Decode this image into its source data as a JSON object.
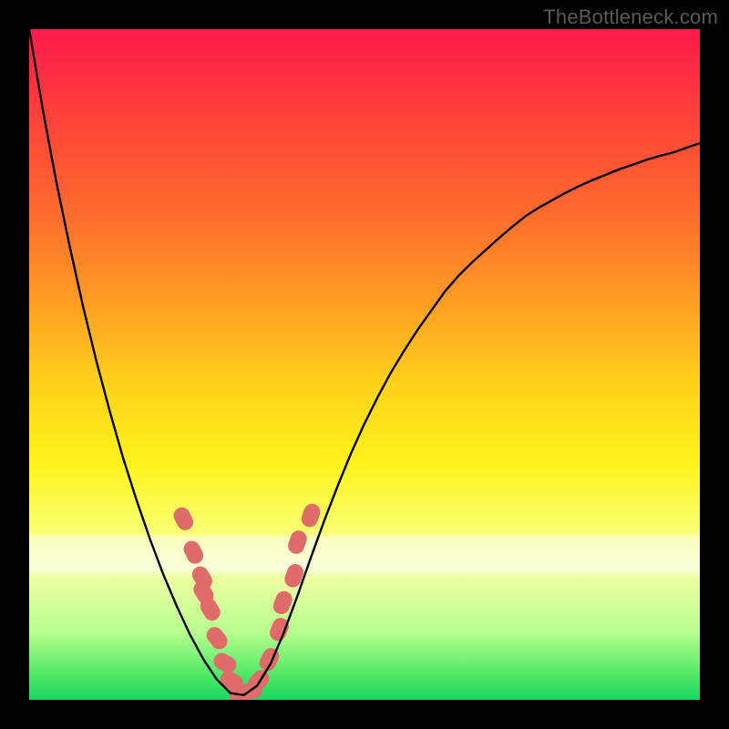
{
  "watermark": "TheBottleneck.com",
  "colors": {
    "frame": "#000000",
    "curve": "#000000",
    "marker_fill": "#e06b6b",
    "marker_stroke": "#c24e4e",
    "gradient_top": "#ff1a4b",
    "gradient_bottom": "#18d85e"
  },
  "chart_data": {
    "type": "line",
    "title": "",
    "xlabel": "",
    "ylabel": "",
    "x": [
      0.0,
      0.02,
      0.04,
      0.06,
      0.08,
      0.1,
      0.12,
      0.14,
      0.16,
      0.18,
      0.2,
      0.22,
      0.24,
      0.26,
      0.28,
      0.3,
      0.32,
      0.34,
      0.36,
      0.38,
      0.4,
      0.42,
      0.44,
      0.46,
      0.48,
      0.5,
      0.52,
      0.54,
      0.56,
      0.58,
      0.6,
      0.62,
      0.64,
      0.66,
      0.68,
      0.7,
      0.72,
      0.74,
      0.76,
      0.78,
      0.8,
      0.82,
      0.84,
      0.86,
      0.88,
      0.9,
      0.92,
      0.94,
      0.96,
      0.98,
      1.0
    ],
    "y": [
      1.0,
      0.882,
      0.775,
      0.678,
      0.588,
      0.506,
      0.431,
      0.361,
      0.298,
      0.24,
      0.187,
      0.14,
      0.097,
      0.06,
      0.03,
      0.01,
      0.007,
      0.021,
      0.054,
      0.101,
      0.155,
      0.212,
      0.267,
      0.319,
      0.368,
      0.412,
      0.452,
      0.489,
      0.522,
      0.553,
      0.581,
      0.609,
      0.632,
      0.652,
      0.67,
      0.688,
      0.705,
      0.721,
      0.734,
      0.745,
      0.756,
      0.766,
      0.775,
      0.783,
      0.791,
      0.798,
      0.805,
      0.811,
      0.816,
      0.823,
      0.83
    ],
    "xlim": [
      0,
      1
    ],
    "ylim": [
      0,
      1
    ],
    "legend": false,
    "grid": false,
    "markers": {
      "description": "salmon-pink capsules highlighting both sides of the valley near the bottom",
      "points": [
        {
          "x": 0.23,
          "y": 0.27
        },
        {
          "x": 0.245,
          "y": 0.22
        },
        {
          "x": 0.258,
          "y": 0.182
        },
        {
          "x": 0.26,
          "y": 0.16
        },
        {
          "x": 0.27,
          "y": 0.135
        },
        {
          "x": 0.28,
          "y": 0.092
        },
        {
          "x": 0.292,
          "y": 0.055
        },
        {
          "x": 0.302,
          "y": 0.028
        },
        {
          "x": 0.315,
          "y": 0.01
        },
        {
          "x": 0.33,
          "y": 0.013
        },
        {
          "x": 0.342,
          "y": 0.028
        },
        {
          "x": 0.358,
          "y": 0.06
        },
        {
          "x": 0.373,
          "y": 0.105
        },
        {
          "x": 0.378,
          "y": 0.145
        },
        {
          "x": 0.395,
          "y": 0.185
        },
        {
          "x": 0.4,
          "y": 0.235
        },
        {
          "x": 0.42,
          "y": 0.275
        }
      ]
    }
  }
}
